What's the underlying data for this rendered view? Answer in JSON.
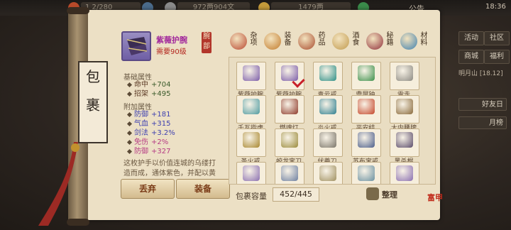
{
  "topbar": {
    "energy": "1 2/280",
    "silver": "972两904文",
    "gold": "1479两",
    "announce": "公告",
    "time": "18:36"
  },
  "rightpanel": {
    "buttons": [
      "活动",
      "社区",
      "商城",
      "福利"
    ],
    "location": "明月山 [18.12]",
    "options": [
      "好友日",
      "月榜"
    ]
  },
  "title": [
    "包",
    "裹"
  ],
  "categories": [
    {
      "label": "杂项",
      "color": "#b8462f"
    },
    {
      "label": "装备",
      "color": "#c27a2a"
    },
    {
      "label": "药品",
      "color": "#a84b2d"
    },
    {
      "label": "酒食",
      "color": "#c19a4d"
    },
    {
      "label": "秘籍",
      "color": "#8f2f3b"
    },
    {
      "label": "材料",
      "color": "#3d7fae"
    }
  ],
  "detail": {
    "name": "紫薇护腕",
    "requirement": "需要90级",
    "slot": "腕部",
    "base_title": "基础属性",
    "base": [
      {
        "k": "命中",
        "v": "+704"
      },
      {
        "k": "招架",
        "v": "+495"
      }
    ],
    "extra_title": "附加属性",
    "extra": [
      {
        "k": "防御",
        "v": "+181",
        "c": "blue"
      },
      {
        "k": "气血",
        "v": "+315",
        "c": "blue"
      },
      {
        "k": "剑法",
        "v": "+3.2%",
        "c": "blue"
      },
      {
        "k": "免伤",
        "v": "+2%",
        "c": "pink"
      },
      {
        "k": "防御",
        "v": "+327",
        "c": "pink"
      }
    ],
    "description": "这枚护手以价值连城的乌缕打造而成，通体紫色，并配以黄金镶嵌，十分昂贵，防御出众",
    "discard": "丢弃",
    "equip": "装备"
  },
  "inventory": [
    {
      "name": "紫薇护腕",
      "color": "#7b5ca8"
    },
    {
      "name": "紫薇护腕",
      "color": "#7b5ca8"
    },
    {
      "name": "青云戒",
      "color": "#2f8f86"
    },
    {
      "name": "鼎屏钟",
      "color": "#3c8f4a"
    },
    {
      "name": "雪走",
      "color": "#8d8a82"
    },
    {
      "name": "千瓦指虎",
      "color": "#4e9aa0"
    },
    {
      "name": "燃魂灯",
      "color": "#8e3a2a"
    },
    {
      "name": "炎火戒",
      "color": "#2f7f8f"
    },
    {
      "name": "平安结",
      "color": "#c4462a"
    },
    {
      "name": "大内腰牌",
      "color": "#8a6a3b"
    },
    {
      "name": "圣火戒",
      "color": "#a8872f"
    },
    {
      "name": "蛟龙宝刀",
      "color": "#9a8a3a"
    },
    {
      "name": "伏羲刀",
      "color": "#7a7468"
    },
    {
      "name": "苏布宝戒",
      "color": "#4b5d8a"
    },
    {
      "name": "黑杀棍",
      "color": "#5a4b6a"
    },
    {
      "name": "",
      "color": "#8a6fb0"
    },
    {
      "name": "",
      "color": "#6d7fa0"
    },
    {
      "name": "",
      "color": "#a09060"
    },
    {
      "name": "",
      "color": "#6a90a0"
    },
    {
      "name": "",
      "color": "#8a6fb0"
    }
  ],
  "capacity_label": "包裹容量",
  "capacity_value": "452/445",
  "sort_label": "整理",
  "logo": "富甲"
}
